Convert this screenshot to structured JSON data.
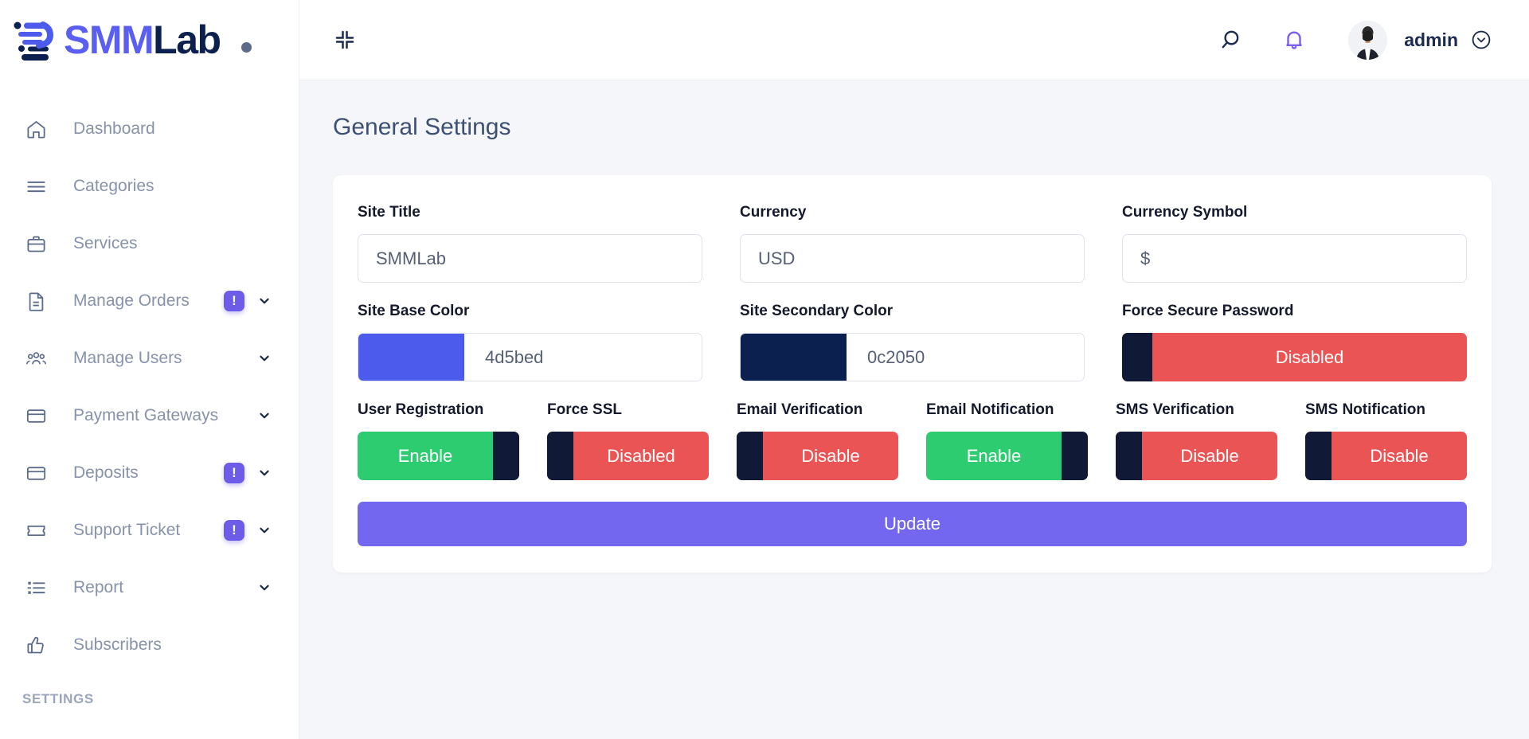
{
  "brand": {
    "name_part1": "SMM",
    "name_part2": "Lab",
    "logo_icon": "smmlab-logo-icon",
    "dot": ""
  },
  "sidebar": {
    "items": [
      {
        "label": "Dashboard",
        "icon": "home-icon",
        "badge": "",
        "chevron": false
      },
      {
        "label": "Categories",
        "icon": "list-lines-icon",
        "badge": "",
        "chevron": false
      },
      {
        "label": "Services",
        "icon": "briefcase-icon",
        "badge": "",
        "chevron": false
      },
      {
        "label": "Manage Orders",
        "icon": "document-icon",
        "badge": "!",
        "chevron": true
      },
      {
        "label": "Manage Users",
        "icon": "users-group-icon",
        "badge": "",
        "chevron": true
      },
      {
        "label": "Payment Gateways",
        "icon": "credit-card-icon",
        "badge": "",
        "chevron": true
      },
      {
        "label": "Deposits",
        "icon": "credit-card-icon",
        "badge": "!",
        "chevron": true
      },
      {
        "label": "Support Ticket",
        "icon": "ticket-icon",
        "badge": "!",
        "chevron": true
      },
      {
        "label": "Report",
        "icon": "report-list-icon",
        "badge": "",
        "chevron": true
      },
      {
        "label": "Subscribers",
        "icon": "thumbs-up-icon",
        "badge": "",
        "chevron": false
      }
    ],
    "section_label": "SETTINGS"
  },
  "topbar": {
    "collapse_icon": "collapse-icon",
    "search_icon": "search-icon",
    "bell_icon": "bell-icon",
    "avatar_icon": "avatar",
    "user_name": "admin",
    "chevron_icon": "chevron-down-icon"
  },
  "page": {
    "title": "General Settings"
  },
  "form": {
    "site_title": {
      "label": "Site Title",
      "value": "SMMLab"
    },
    "currency": {
      "label": "Currency",
      "value": "USD"
    },
    "currency_symbol": {
      "label": "Currency Symbol",
      "value": "$"
    },
    "site_base_color": {
      "label": "Site Base Color",
      "value": "4d5bed",
      "swatch": "#4d5bed"
    },
    "site_secondary_color": {
      "label": "Site Secondary Color",
      "value": "0c2050",
      "swatch": "#0c2050"
    },
    "force_secure_password": {
      "label": "Force Secure Password",
      "state": "off",
      "text": "Disabled"
    },
    "toggles": [
      {
        "label": "User Registration",
        "state": "on",
        "text": "Enable"
      },
      {
        "label": "Force SSL",
        "state": "off",
        "text": "Disabled"
      },
      {
        "label": "Email Verification",
        "state": "off",
        "text": "Disable"
      },
      {
        "label": "Email Notification",
        "state": "on",
        "text": "Enable"
      },
      {
        "label": "SMS Verification",
        "state": "off",
        "text": "Disable"
      },
      {
        "label": "SMS Notification",
        "state": "off",
        "text": "Disable"
      }
    ],
    "update_button": "Update"
  },
  "colors": {
    "accent_purple": "#6c5ce7",
    "button_purple": "#7367ef",
    "toggle_on_green": "#2ecc71",
    "toggle_off_red": "#ea5455",
    "knob_navy": "#101935",
    "page_bg": "#f5f6fa"
  }
}
